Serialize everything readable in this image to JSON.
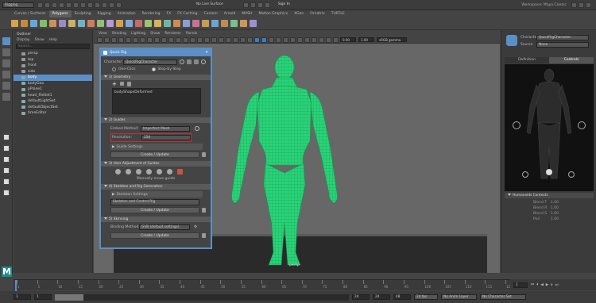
{
  "status_line": {
    "mode": "Rigging",
    "live_surface": "No Live Surface",
    "signin": "Sign In",
    "workspace": "Workspace: Maya Classic"
  },
  "shelf_tabs": [
    "Curves / Surfaces",
    "Polygons",
    "Sculpting",
    "Rigging",
    "Animation",
    "Rendering",
    "FX",
    "FX Caching",
    "Custom",
    "Arnold",
    "MASH",
    "Motion Graphics",
    "XGen",
    "Ornatrix",
    "TURTLE"
  ],
  "shelf_active": 1,
  "outliner": {
    "title": "Outliner",
    "menu": [
      "Display",
      "Show",
      "Help"
    ],
    "search_placeholder": "Search...",
    "items": [
      "persp",
      "top",
      "front",
      "side",
      "body",
      "bodyGeo",
      "pPlane1",
      "head_fileSet1",
      "defaultLightSet",
      "defaultObjectSet",
      "timeEditor"
    ],
    "selected": 4
  },
  "viewport": {
    "menu": [
      "View",
      "Shading",
      "Lighting",
      "Show",
      "Renderer",
      "Panels"
    ],
    "field1": "0.00",
    "field2": "1.00",
    "color_space": "sRGB gamma",
    "camera_label": "persp"
  },
  "quick_rig": {
    "title": "Quick Rig",
    "character_label": "Character:",
    "character_value": "QuickRigCharacter",
    "one_click": "One-Click",
    "step_by_step": "Step-by-Step",
    "sec_geometry": "1) Geometry",
    "geometry_item": "bodyShapeDeformed",
    "sec_guides": "2) Guides",
    "embed_method_label": "Embed Method:",
    "embed_method_value": "Imperfect Mesh",
    "resolution_label": "Resolution:",
    "resolution_value": "256",
    "guide_settings": "Guide Settings",
    "create_update": "Create / Update",
    "sec_user_adjust": "3) User Adjustment of Guides",
    "manually_move": "Manually move guide",
    "sec_skeleton": "4) Skeleton and Rig Generation",
    "skeleton_settings": "Skeleton Settings",
    "skeleton_dropdown": "Skeleton and Control Rig",
    "sec_skinning": "5) Skinning",
    "binding_label": "Binding Method:",
    "binding_value": "GVB (default settings)"
  },
  "hik": {
    "character_label": "Character",
    "character_value": "QuickRigCharacter",
    "source_label": "Source",
    "source_value": "None",
    "tabs": [
      "Definition",
      "Controls"
    ],
    "active_tab": 1,
    "section": "Humanoids Contexts",
    "rows": [
      "Blend T",
      "Blend R",
      "Blend S",
      "Pull"
    ],
    "value": "1.00"
  },
  "timeline": {
    "ticks": [
      "1",
      "5",
      "10",
      "15",
      "20",
      "25",
      "30",
      "35",
      "40",
      "45",
      "50",
      "55",
      "60",
      "65",
      "70",
      "75",
      "80",
      "85",
      "90",
      "95",
      "100",
      "105",
      "110",
      "115",
      "120"
    ],
    "current_frame": "1",
    "start": "1",
    "range_start": "1",
    "range_end": "24",
    "end": "24",
    "end2": "48",
    "fps": "24 fps",
    "anim_layer": "No Anim Layer",
    "char_set": "No Character Set"
  },
  "colors": {
    "accent": "#5b8fc6",
    "mesh": "#2ee07f",
    "highlight": "#c0313a"
  },
  "icons": [
    "mode-dropdown",
    "shelf-icons",
    "tool-box",
    "quick-rig-tools",
    "hik-figure",
    "playback-controls"
  ]
}
